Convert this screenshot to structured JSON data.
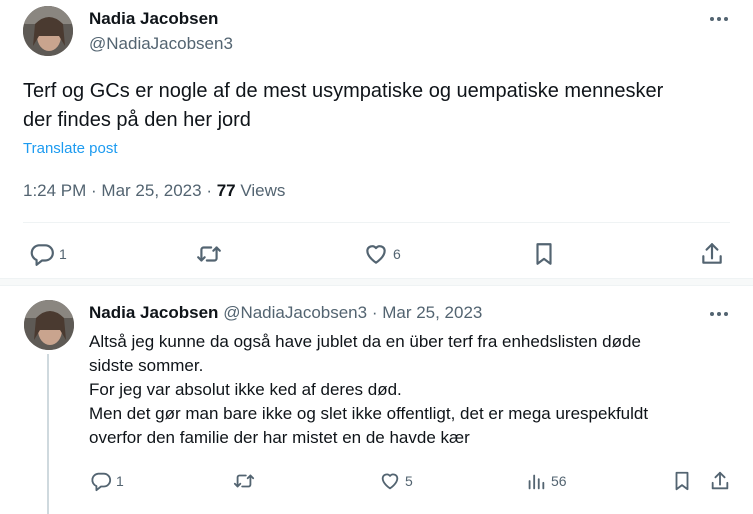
{
  "main_post": {
    "author_name": "Nadia Jacobsen",
    "handle": "@NadiaJacobsen3",
    "text_line1": "Terf og GCs er nogle af de mest usympatiske og uempatiske mennesker",
    "text_line2": "der findes på den her jord",
    "translate_label": "Translate post",
    "time": "1:24 PM",
    "date": "Mar 25, 2023",
    "views_count": "77",
    "views_label": "Views",
    "replies": "1",
    "likes": "6"
  },
  "reply_post": {
    "author_name": "Nadia Jacobsen",
    "handle": "@NadiaJacobsen3",
    "date": "Mar 25, 2023",
    "lines": [
      "Altså jeg kunne da også have jublet da en über terf fra enhedslisten døde",
      "sidste sommer.",
      "For jeg var absolut ikke ked af deres død.",
      "Men det gør man bare ikke og slet ikke offentligt, det er mega urespekfuldt",
      "overfor den familie der har mistet en de havde kær"
    ],
    "replies": "1",
    "likes": "5",
    "views": "56"
  },
  "colors": {
    "link": "#1d9bf0",
    "muted": "#536471",
    "text": "#0f1419",
    "divider": "#eff3f4"
  },
  "icons": [
    "more-icon",
    "reply-icon",
    "retweet-icon",
    "like-icon",
    "bookmark-icon",
    "share-icon",
    "views-icon"
  ]
}
